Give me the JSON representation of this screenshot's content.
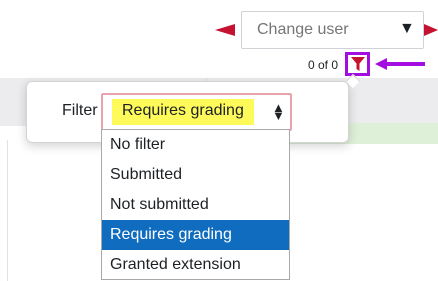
{
  "change_user": {
    "placeholder": "Change user"
  },
  "status": {
    "count_text": "0 of 0"
  },
  "filter": {
    "label": "Filter",
    "selected_value": "Requires grading",
    "options": [
      {
        "label": "No filter",
        "selected": false
      },
      {
        "label": "Submitted",
        "selected": false
      },
      {
        "label": "Not submitted",
        "selected": false
      },
      {
        "label": "Requires grading",
        "selected": true
      },
      {
        "label": "Granted extension",
        "selected": false
      }
    ]
  },
  "colors": {
    "accent_blue": "#0f6cbf",
    "annotation_red": "#c41230",
    "annotation_purple": "#a30de0",
    "highlight_yellow": "#fdfa59"
  },
  "icons": {
    "filter": "funnel-icon",
    "caret": "caret-down-icon",
    "updown": "sort-updown-icon"
  }
}
